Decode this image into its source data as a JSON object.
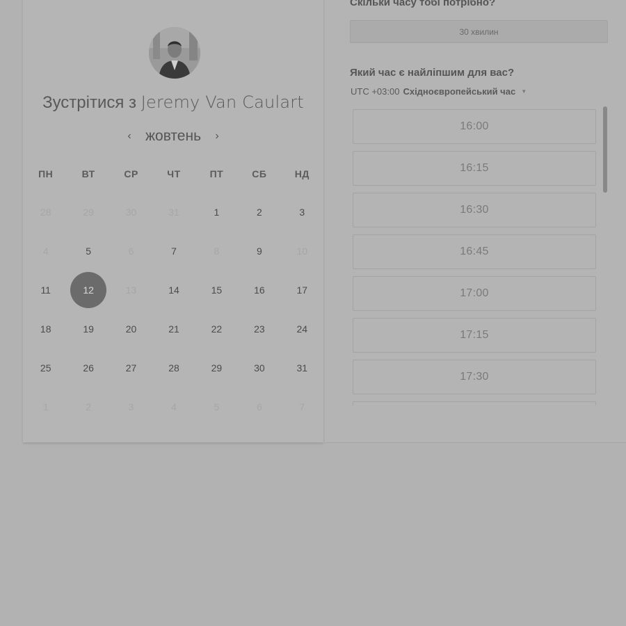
{
  "host": {
    "title_prefix": "Зустрітися з",
    "name": "Jeremy Van Caulart"
  },
  "calendar": {
    "month": "жовтень",
    "prev_icon": "chevron-left-icon",
    "next_icon": "chevron-right-icon",
    "weekdays": [
      "ПН",
      "ВТ",
      "СР",
      "ЧТ",
      "ПТ",
      "СБ",
      "НД"
    ],
    "weeks": [
      [
        {
          "d": "28",
          "s": "muted"
        },
        {
          "d": "29",
          "s": "muted"
        },
        {
          "d": "30",
          "s": "muted"
        },
        {
          "d": "31",
          "s": "muted"
        },
        {
          "d": "1",
          "s": "available"
        },
        {
          "d": "2",
          "s": "available"
        },
        {
          "d": "3",
          "s": "available"
        }
      ],
      [
        {
          "d": "4",
          "s": "muted"
        },
        {
          "d": "5",
          "s": "available"
        },
        {
          "d": "6",
          "s": "muted"
        },
        {
          "d": "7",
          "s": "available"
        },
        {
          "d": "8",
          "s": "muted"
        },
        {
          "d": "9",
          "s": "available"
        },
        {
          "d": "10",
          "s": "muted"
        }
      ],
      [
        {
          "d": "11",
          "s": "available"
        },
        {
          "d": "12",
          "s": "selected"
        },
        {
          "d": "13",
          "s": "muted"
        },
        {
          "d": "14",
          "s": "available"
        },
        {
          "d": "15",
          "s": "available"
        },
        {
          "d": "16",
          "s": "available"
        },
        {
          "d": "17",
          "s": "available"
        }
      ],
      [
        {
          "d": "18",
          "s": "available"
        },
        {
          "d": "19",
          "s": "available"
        },
        {
          "d": "20",
          "s": "available"
        },
        {
          "d": "21",
          "s": "available"
        },
        {
          "d": "22",
          "s": "available"
        },
        {
          "d": "23",
          "s": "available"
        },
        {
          "d": "24",
          "s": "available"
        }
      ],
      [
        {
          "d": "25",
          "s": "available"
        },
        {
          "d": "26",
          "s": "available"
        },
        {
          "d": "27",
          "s": "available"
        },
        {
          "d": "28",
          "s": "available"
        },
        {
          "d": "29",
          "s": "available"
        },
        {
          "d": "30",
          "s": "available"
        },
        {
          "d": "31",
          "s": "available"
        }
      ],
      [
        {
          "d": "1",
          "s": "muted"
        },
        {
          "d": "2",
          "s": "muted"
        },
        {
          "d": "3",
          "s": "muted"
        },
        {
          "d": "4",
          "s": "muted"
        },
        {
          "d": "5",
          "s": "muted"
        },
        {
          "d": "6",
          "s": "muted"
        },
        {
          "d": "7",
          "s": "muted"
        }
      ]
    ],
    "selected_day": "12"
  },
  "booking": {
    "duration_question": "Скільки часу тобі потрібно?",
    "duration_value": "30 хвилин",
    "time_question": "Який час є найліпшим для вас?",
    "timezone_offset": "UTC +03:00",
    "timezone_name": "Східноєвропейський час",
    "timezone_caret_icon": "caret-down-icon",
    "slots": [
      "16:00",
      "16:15",
      "16:30",
      "16:45",
      "17:00",
      "17:15",
      "17:30",
      ""
    ]
  }
}
